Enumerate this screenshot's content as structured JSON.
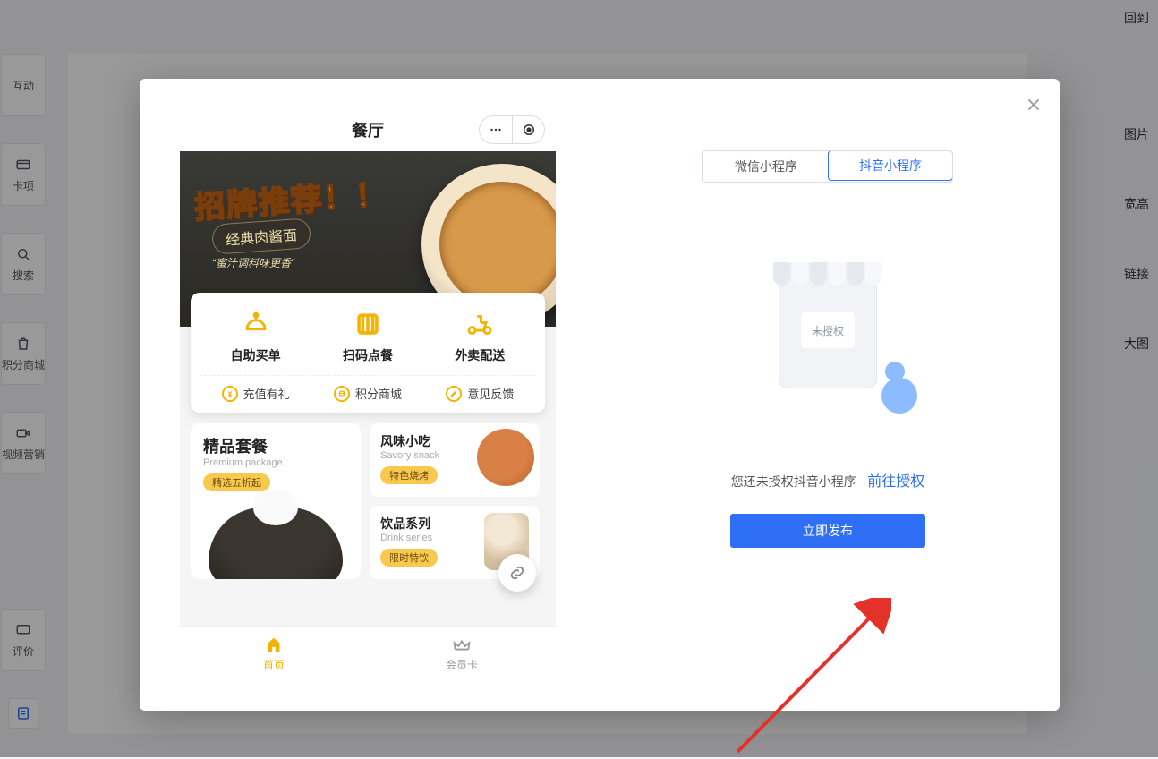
{
  "topbar": {
    "return": "回到"
  },
  "left_rail": [
    {
      "label": "互动"
    },
    {
      "label": "卡项"
    },
    {
      "label": "搜索"
    },
    {
      "label": "积分商城"
    },
    {
      "label": "视频营销"
    },
    {
      "label": "评价"
    }
  ],
  "right_labels": [
    "图片",
    "宽高",
    "链接",
    "大图"
  ],
  "modal": {
    "tabs": {
      "wechat": "微信小程序",
      "douyin": "抖音小程序"
    },
    "illustration_sign": "未授权",
    "auth_msg": "您还未授权抖音小程序",
    "auth_link": "前往授权",
    "publish": "立即发布"
  },
  "phone": {
    "title": "餐厅",
    "hero": {
      "title": "招牌推荐！！",
      "sub1": "经典肉酱面",
      "sub2": "“蜜汁调料味更香”"
    },
    "big_actions": [
      "自助买单",
      "扫码点餐",
      "外卖配送"
    ],
    "small_actions": [
      "充值有礼",
      "积分商城",
      "意见反馈"
    ],
    "promo_main": {
      "title": "精品套餐",
      "sub": "Premium package",
      "tag": "精选五折起"
    },
    "promo_a": {
      "title": "风味小吃",
      "sub": "Savory snack",
      "tag": "特色烧烤"
    },
    "promo_b": {
      "title": "饮品系列",
      "sub": "Drink series",
      "tag": "限时特饮"
    },
    "tabs": {
      "home": "首页",
      "member": "会员卡"
    }
  }
}
